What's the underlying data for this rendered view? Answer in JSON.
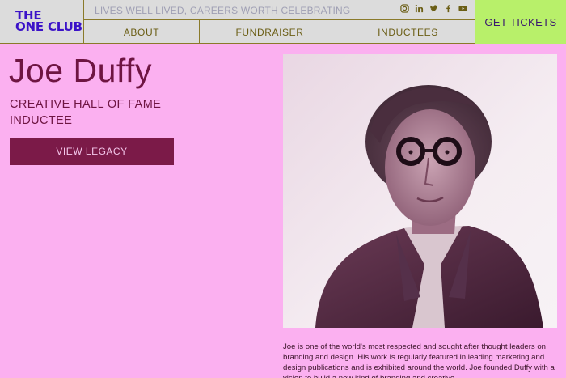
{
  "header": {
    "logo_line1": "THE",
    "logo_line2": "ONE CLUB",
    "tagline": "LIVES WELL LIVED, CAREERS WORTH CELEBRATING",
    "socials": [
      "instagram-icon",
      "linkedin-icon",
      "twitter-icon",
      "facebook-icon",
      "youtube-icon"
    ],
    "nav": {
      "about": "ABOUT",
      "fundraiser": "FUNDRAISER",
      "inductees": "INDUCTEES"
    },
    "cta": "GET TICKETS"
  },
  "profile": {
    "name": "Joe Duffy",
    "subtitle": "CREATIVE HALL OF FAME INDUCTEE",
    "button": "VIEW LEGACY",
    "bio": "Joe is one of the world's most respected and sought after thought leaders on branding and design. His work is regularly featured in leading marketing and design publications and is exhibited around the world. Joe founded Duffy with a vision to build a new kind of branding and creative"
  },
  "colors": {
    "background": "#fbb0f0",
    "logo": "#3b12c8",
    "cta_bg": "#b8f06a",
    "button_bg": "#7b1a48",
    "heading": "#6e1542"
  }
}
